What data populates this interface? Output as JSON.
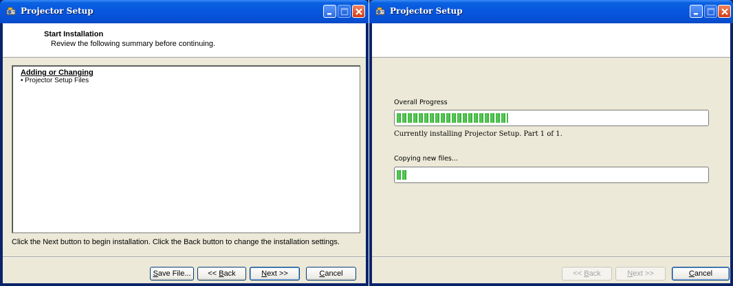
{
  "window1": {
    "title": "Projector Setup",
    "header_title": "Start Installation",
    "header_subtitle": "Review the following summary before continuing.",
    "summary_heading": "Adding or Changing",
    "summary_items": [
      "• Projector Setup Files"
    ],
    "instruction": "Click the Next button to begin installation.  Click the Back button to change the installation settings.",
    "buttons": {
      "save_prefix": "",
      "save_ul": "S",
      "save_rest": "ave File...",
      "back_prefix": "<< ",
      "back_ul": "B",
      "back_rest": "ack",
      "next_prefix": "",
      "next_ul": "N",
      "next_rest": "ext >>",
      "cancel_prefix": "",
      "cancel_ul": "C",
      "cancel_rest": "ancel"
    }
  },
  "window2": {
    "title": "Projector Setup",
    "overall_label": "Overall Progress",
    "overall_progress": 0.36,
    "status_text": "Currently installing Projector Setup.  Part 1 of 1.",
    "file_label": "Copying new files...",
    "file_progress": 0.03,
    "buttons": {
      "back_prefix": "<< ",
      "back_ul": "B",
      "back_rest": "ack",
      "next_prefix": "",
      "next_ul": "N",
      "next_rest": "ext >>",
      "cancel_prefix": "",
      "cancel_ul": "C",
      "cancel_rest": "ancel"
    }
  },
  "icons": {
    "app": "projector-icon",
    "minimize": "minimize-icon",
    "maximize": "maximize-icon",
    "close": "close-icon"
  },
  "colors": {
    "titlebar": "#0855dd",
    "frame": "#ece9d8",
    "progress": "#3ab33a",
    "close_button": "#d23c13"
  }
}
